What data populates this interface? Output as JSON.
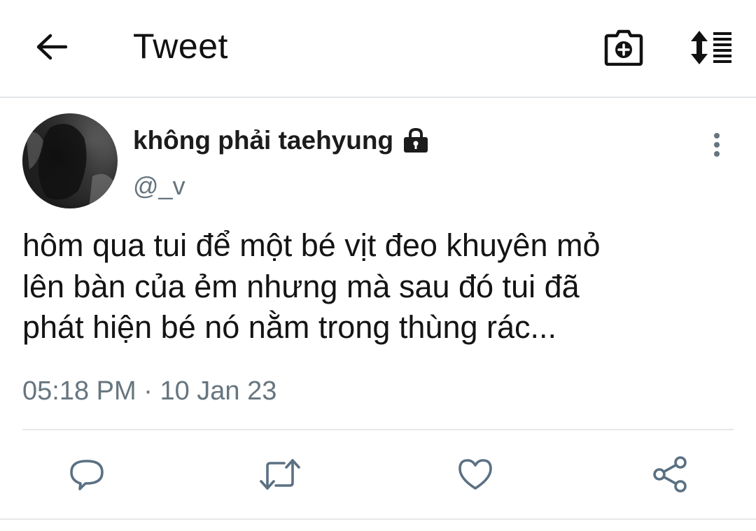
{
  "header": {
    "back_icon": "arrow-left-icon",
    "title": "Tweet",
    "camera_icon": "camera-plus-icon",
    "sort_icon": "sort-list-icon"
  },
  "tweet": {
    "author": {
      "display_name": "không phải taehyung",
      "handle": "@_v",
      "protected_icon": "lock-icon",
      "avatar": "profile-photo"
    },
    "more_icon": "more-vertical-icon",
    "text_lines": [
      "hôm qua tui để một bé vịt đeo khuyên mỏ",
      "lên bàn của ẻm nhưng mà sau đó tui đã",
      "phát hiện bé nó nằm trong thùng rác..."
    ],
    "time": "05:18 PM",
    "separator": "·",
    "date": "10 Jan 23"
  },
  "actions": {
    "reply_icon": "reply-icon",
    "retweet_icon": "retweet-icon",
    "like_icon": "heart-icon",
    "share_icon": "share-icon"
  },
  "colors": {
    "text_primary": "#141414",
    "text_secondary": "#66757f",
    "icon_action": "#5b7083",
    "divider": "#e6e8ea"
  }
}
